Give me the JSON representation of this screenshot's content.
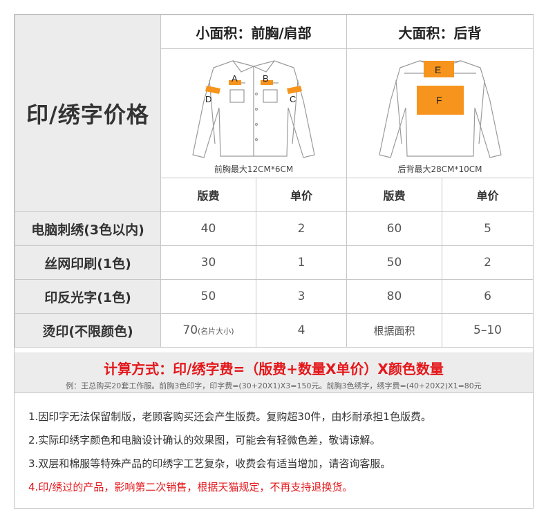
{
  "title": "印/绣字价格",
  "small_area": {
    "heading": "小面积：前胸/肩部",
    "caption": "前胸最大12CM*6CM",
    "markers": [
      "A",
      "B",
      "C",
      "D"
    ]
  },
  "large_area": {
    "heading": "大面积：后背",
    "caption": "后背最大28CM*10CM",
    "markers": [
      "E",
      "F"
    ]
  },
  "columns": {
    "plate_fee": "版费",
    "unit_price": "单价"
  },
  "rows": [
    {
      "label": "电脑刺绣(3色以内)",
      "small_plate": "40",
      "small_unit": "2",
      "large_plate": "60",
      "large_unit": "5"
    },
    {
      "label": "丝网印刷(1色)",
      "small_plate": "30",
      "small_unit": "1",
      "large_plate": "50",
      "large_unit": "2"
    },
    {
      "label": "印反光字(1色)",
      "small_plate": "50",
      "small_unit": "3",
      "large_plate": "80",
      "large_unit": "6"
    },
    {
      "label": "烫印(不限颜色)",
      "small_plate": "70",
      "small_plate_note": "(名片大小)",
      "small_unit": "4",
      "large_plate": "根据面积",
      "large_unit": "5–10"
    }
  ],
  "formula": "计算方式：印/绣字费=（版费+数量X单价）X颜色数量",
  "example": "例：王总购买20套工作服。前胸3色印字，印字费=(30+20X1)X3=150元。前胸3色绣字，绣字费=(40+20X2)X1=80元",
  "notes": [
    "1.因印字无法保留制版，老顾客购买还会产生版费。复购超30件，由杉耐承担1色版费。",
    "2.实际印绣字颜色和电脑设计确认的效果图，可能会有轻微色差，敬请谅解。",
    "3.双层和棉服等特殊产品的印绣字工艺复杂，收费会有适当增加，请咨询客服。",
    "4.印/绣过的产品，影响第二次销售，根据天猫规定，不再支持退换货。"
  ],
  "colors": {
    "accent": "#e4171b",
    "marker_orange": "#f7941d",
    "header_gray": "#ececec"
  }
}
